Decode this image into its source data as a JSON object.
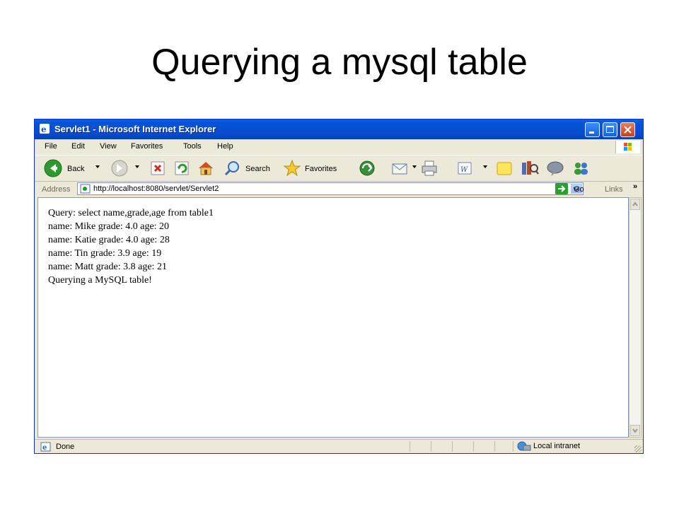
{
  "slide": {
    "title": "Querying a mysql table"
  },
  "window": {
    "title": "Servlet1 - Microsoft Internet Explorer",
    "menu": [
      "File",
      "Edit",
      "View",
      "Favorites",
      "Tools",
      "Help"
    ],
    "toolbar": {
      "back_label": "Back",
      "search_label": "Search",
      "favorites_label": "Favorites"
    },
    "address": {
      "label": "Address",
      "url": "http://localhost:8080/servlet/Servlet2",
      "go_label": "Go",
      "links_label": "Links"
    },
    "content_lines": [
      "Query: select name,grade,age from table1",
      "name: Mike grade: 4.0 age: 20",
      "name: Katie grade: 4.0 age: 28",
      "name: Tin grade: 3.9 age: 19",
      "name: Matt grade: 3.8 age: 21",
      "Querying a MySQL table!"
    ],
    "status": {
      "text": "Done",
      "zone": "Local intranet"
    },
    "colors": {
      "titlebar": "#0a4bd0",
      "chrome": "#ece9d8",
      "close": "#c4411b"
    }
  }
}
